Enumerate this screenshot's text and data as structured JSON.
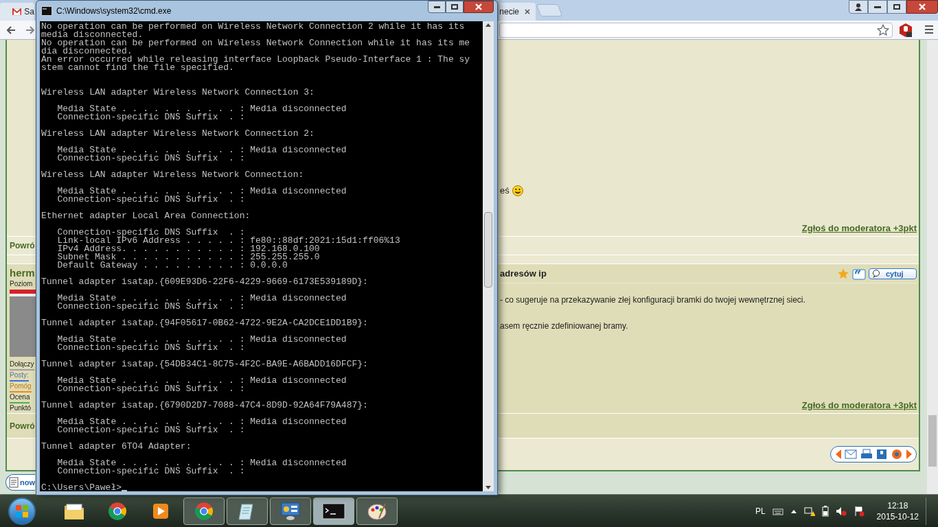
{
  "browser": {
    "tabs": [
      {
        "label": "Sa",
        "kind": "mail"
      },
      {
        "label": "necie",
        "kind": "page"
      }
    ]
  },
  "forum": {
    "back_link_top": "Powró",
    "author": "herm",
    "level_label": "Poziom",
    "joined_label": "Dołączy",
    "posts_label": "Posty:",
    "helped_label": "Pomóg",
    "rating_label": "Ocena",
    "points_label": "Punktó",
    "back_link_bottom": "Powró",
    "previous_post": {
      "text_tail": "eś",
      "report_link": "Zgłoś do moderatora +3pkt"
    },
    "post": {
      "title_tail": "adresów ip",
      "quote_button": "cytuj",
      "lines": [
        "- co sugeruje na przekazywanie złej konfiguracji bramki do twojej wewnętrznej sieci.",
        "asem ręcznie zdefiniowanej bramy."
      ],
      "report_link": "Zgłoś do moderatora +3pkt"
    },
    "new_topic_button": "now"
  },
  "console": {
    "title": "C:\\Windows\\system32\\cmd.exe",
    "sections": [
      {
        "lines": [
          "No operation can be performed on Wireless Network Connection 2 while it has its",
          "media disconnected.",
          "No operation can be performed on Wireless Network Connection while it has its me",
          "dia disconnected.",
          "An error occurred while releasing interface Loopback Pseudo-Interface 1 : The sy",
          "stem cannot find the file specified."
        ]
      },
      {
        "lines": [
          "Wireless LAN adapter Wireless Network Connection 3:"
        ]
      },
      {
        "lines": [
          "   Media State . . . . . . . . . . . : Media disconnected",
          "   Connection-specific DNS Suffix  . :"
        ]
      },
      {
        "lines": [
          "Wireless LAN adapter Wireless Network Connection 2:"
        ]
      },
      {
        "lines": [
          "   Media State . . . . . . . . . . . : Media disconnected",
          "   Connection-specific DNS Suffix  . :"
        ]
      },
      {
        "lines": [
          "Wireless LAN adapter Wireless Network Connection:"
        ]
      },
      {
        "lines": [
          "   Media State . . . . . . . . . . . : Media disconnected",
          "   Connection-specific DNS Suffix  . :"
        ]
      },
      {
        "lines": [
          "Ethernet adapter Local Area Connection:"
        ]
      },
      {
        "lines": [
          "   Connection-specific DNS Suffix  . :",
          "   Link-local IPv6 Address . . . . . : fe80::88df:2021:15d1:ff06%13",
          "   IPv4 Address. . . . . . . . . . . : 192.168.0.100",
          "   Subnet Mask . . . . . . . . . . . : 255.255.255.0",
          "   Default Gateway . . . . . . . . . : 0.0.0.0"
        ]
      },
      {
        "lines": [
          "Tunnel adapter isatap.{609E93D6-22F6-4229-9669-6173E539189D}:"
        ]
      },
      {
        "lines": [
          "   Media State . . . . . . . . . . . : Media disconnected",
          "   Connection-specific DNS Suffix  . :"
        ]
      },
      {
        "lines": [
          "Tunnel adapter isatap.{94F05617-0B62-4722-9E2A-CA2DCE1DD1B9}:"
        ]
      },
      {
        "lines": [
          "   Media State . . . . . . . . . . . : Media disconnected",
          "   Connection-specific DNS Suffix  . :"
        ]
      },
      {
        "lines": [
          "Tunnel adapter isatap.{54DB34C1-8C75-4F2C-BA9E-A6BADD16DFCF}:"
        ]
      },
      {
        "lines": [
          "   Media State . . . . . . . . . . . : Media disconnected",
          "   Connection-specific DNS Suffix  . :"
        ]
      },
      {
        "lines": [
          "Tunnel adapter isatap.{6790D2D7-7088-47C4-8D9D-92A64F79A487}:"
        ]
      },
      {
        "lines": [
          "   Media State . . . . . . . . . . . : Media disconnected",
          "   Connection-specific DNS Suffix  . :"
        ]
      },
      {
        "lines": [
          "Tunnel adapter 6TO4 Adapter:"
        ]
      },
      {
        "lines": [
          "   Media State . . . . . . . . . . . : Media disconnected",
          "   Connection-specific DNS Suffix  . :"
        ]
      }
    ],
    "prompt": "C:\\Users\\Paweł>"
  },
  "taskbar": {
    "apps": [
      {
        "kind": "folder",
        "running": false,
        "active": false
      },
      {
        "kind": "browser",
        "running": false,
        "active": false
      },
      {
        "kind": "media",
        "running": false,
        "active": false
      },
      {
        "kind": "browser",
        "running": true,
        "active": false
      },
      {
        "kind": "notepad",
        "running": true,
        "active": false
      },
      {
        "kind": "control",
        "running": true,
        "active": false
      },
      {
        "kind": "console",
        "running": true,
        "active": true
      },
      {
        "kind": "paint",
        "running": true,
        "active": false
      }
    ],
    "language": "PL",
    "time": "12:18",
    "date": "2015-10-12"
  }
}
